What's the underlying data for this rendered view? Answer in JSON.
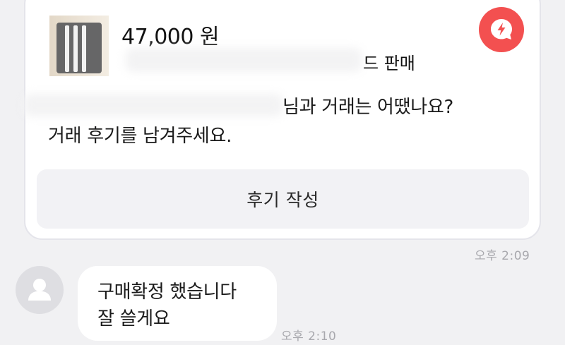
{
  "card": {
    "price": "47,000 원",
    "title_suffix": "드 판매",
    "badge_icon": "lightning-chat-icon",
    "badge_color": "#f35050",
    "message_line1": "님과 거래는 어땠나요?",
    "message_line2": "거래 후기를 남겨주세요.",
    "review_button": "후기 작성"
  },
  "card_time": "오후 2:09",
  "reply": {
    "avatar_icon": "user-avatar-icon",
    "text": "구매확정 했습니다\n잘 쓸게요",
    "time": "오후 2:10"
  }
}
